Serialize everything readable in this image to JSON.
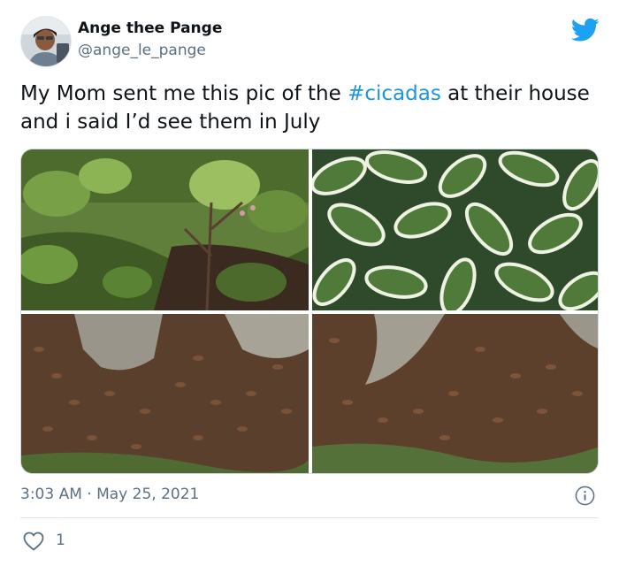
{
  "author": {
    "display_name": "Ange thee Pange",
    "handle": "@ange_le_pange"
  },
  "tweet": {
    "text_before": "My Mom sent me this pic of the ",
    "hashtag": "#cicadas",
    "text_after": " at their house and i said I’d see them in July",
    "timestamp": "3:03 AM · May 25, 2021",
    "like_count": "1"
  },
  "media": {
    "photo_count": 4
  },
  "icons": {
    "brand": "twitter-bird-icon",
    "info": "info-icon",
    "like": "heart-icon"
  },
  "colors": {
    "brand": "#1da1f2",
    "link": "#1b95e0",
    "secondary_text": "#5b7083"
  }
}
